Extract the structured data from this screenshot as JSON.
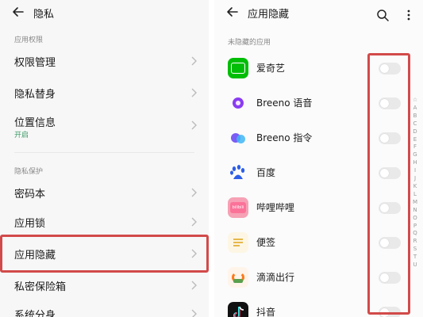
{
  "left": {
    "title": "隐私",
    "sections": [
      {
        "label": "应用权限",
        "items": [
          {
            "label": "权限管理"
          },
          {
            "label": "隐私替身"
          },
          {
            "label": "位置信息",
            "sub": "开启"
          }
        ]
      },
      {
        "label": "隐私保护",
        "items": [
          {
            "label": "密码本"
          },
          {
            "label": "应用锁"
          },
          {
            "label": "应用隐藏"
          },
          {
            "label": "私密保险箱"
          },
          {
            "label": "系统分身"
          }
        ]
      }
    ]
  },
  "right": {
    "title": "应用隐藏",
    "section_label": "未隐藏的应用",
    "apps": [
      {
        "name": "爱奇艺",
        "enabled": false,
        "icon": "iqiyi-icon"
      },
      {
        "name": "Breeno 语音",
        "enabled": false,
        "icon": "breeno-voice-icon"
      },
      {
        "name": "Breeno 指令",
        "enabled": false,
        "icon": "breeno-command-icon"
      },
      {
        "name": "百度",
        "enabled": false,
        "icon": "baidu-icon"
      },
      {
        "name": "哔哩哔哩",
        "enabled": false,
        "icon": "bilibili-icon",
        "icon_text": "bilibili"
      },
      {
        "name": "便签",
        "enabled": false,
        "icon": "notes-icon"
      },
      {
        "name": "滴滴出行",
        "enabled": false,
        "icon": "didi-icon"
      },
      {
        "name": "抖音",
        "enabled": false,
        "icon": "douyin-icon"
      }
    ],
    "index": [
      "☆",
      "A",
      "B",
      "C",
      "D",
      "E",
      "F",
      "G",
      "H",
      "I",
      "J",
      "K",
      "L",
      "M",
      "N",
      "O",
      "P",
      "Q",
      "R",
      "S",
      "T",
      "U"
    ]
  },
  "colors": {
    "highlight": "#d24a4a",
    "section_text": "#888888",
    "sub_text": "#3a9a64"
  }
}
